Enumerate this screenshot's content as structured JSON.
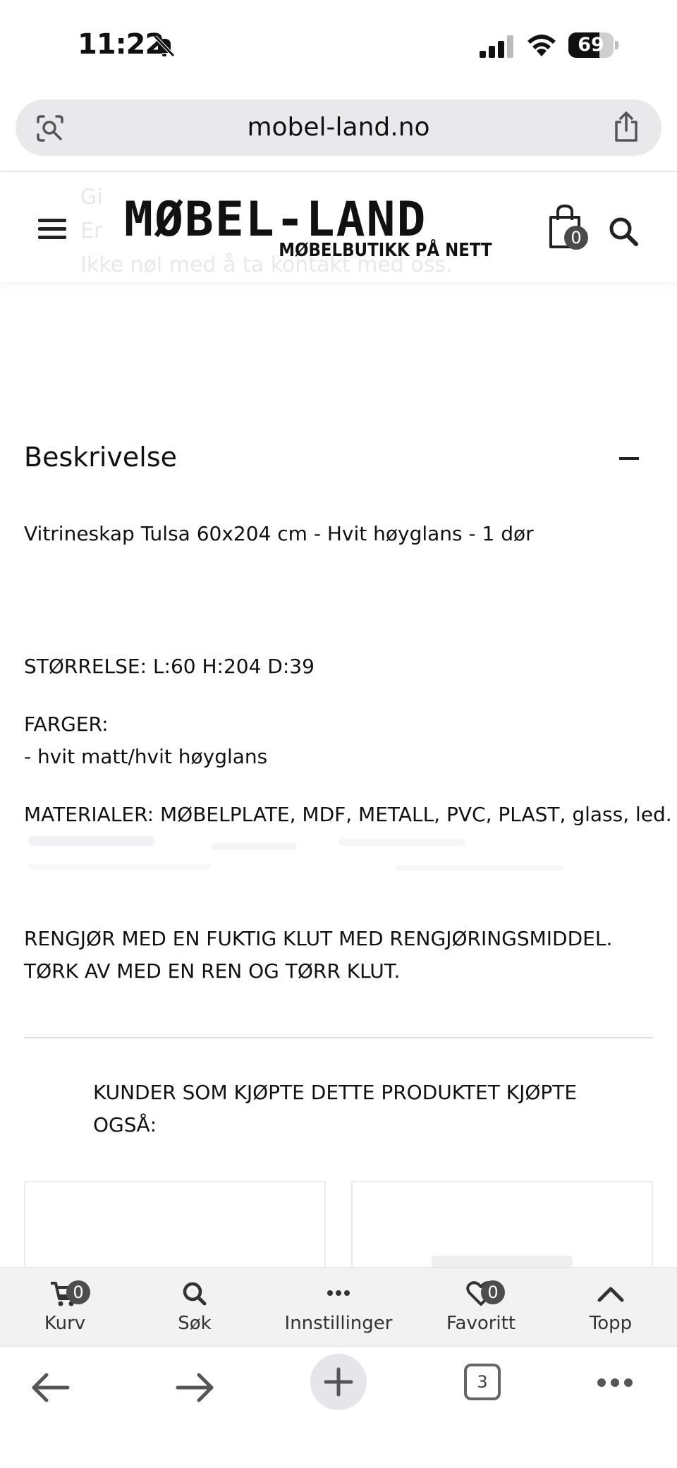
{
  "status_bar": {
    "time": "11:22",
    "battery_level": "69",
    "battery_fraction": 0.69
  },
  "browser": {
    "url": "mobel-land.no",
    "tab_count": "3"
  },
  "header": {
    "logo_main": "MØBEL-LAND",
    "logo_sub": "MØBELBUTIKK PÅ NETT",
    "cart_count": "0",
    "ghost_line_1": "Gi",
    "ghost_line_2": "Er",
    "ghost_line_3": "Ikke nøl med å ta kontakt med oss."
  },
  "description": {
    "title": "Beskrivelse",
    "product_line": "Vitrineskap Tulsa 60x204 cm - Hvit høyglans - 1 dør",
    "size": "STØRRELSE: L:60 H:204 D:39",
    "colors_label": "FARGER:",
    "colors_value": "- hvit matt/hvit høyglans",
    "materials": "MATERIALER: MØBELPLATE, MDF, METALL, PVC, PLAST, glass, led.",
    "care_line_1": "RENGJØR MED EN FUKTIG KLUT MED RENGJØRINGSMIDDEL.",
    "care_line_2": "TØRK AV MED EN REN OG TØRR KLUT."
  },
  "related": {
    "title": "KUNDER SOM KJØPTE DETTE PRODUKTET KJØPTE OGSÅ:"
  },
  "toolbar": {
    "cart_label": "Kurv",
    "cart_badge": "0",
    "search_label": "Søk",
    "settings_label": "Innstillinger",
    "favorites_label": "Favoritt",
    "favorites_badge": "0",
    "top_label": "Topp"
  },
  "icons": {
    "status": [
      "bell-slash-icon",
      "signal-icon",
      "wifi-icon",
      "battery-icon"
    ],
    "url_bar": [
      "visual-lookup-icon",
      "share-icon"
    ],
    "header": [
      "menu-icon",
      "shopping-bag-icon",
      "search-icon"
    ],
    "toolbar": [
      "cart-icon",
      "search-icon",
      "more-dots-icon",
      "heart-icon",
      "chevron-up-icon"
    ],
    "browser": [
      "back-arrow-icon",
      "forward-arrow-icon",
      "plus-icon",
      "tabs-icon",
      "more-icon"
    ]
  }
}
